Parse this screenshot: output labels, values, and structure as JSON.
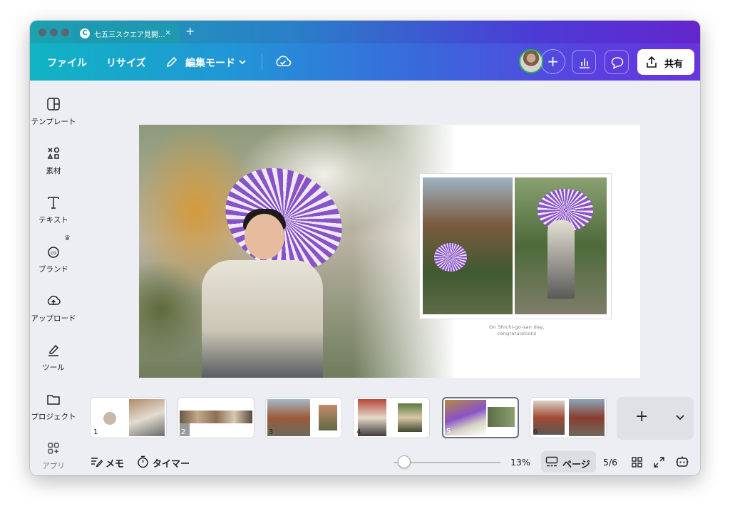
{
  "tab": {
    "title": "七五三スクエア見開...",
    "close": "×",
    "new_tab": "+"
  },
  "toolbar": {
    "file": "ファイル",
    "resize": "リサイズ",
    "edit_mode": "編集モード",
    "add": "+",
    "share": "共有"
  },
  "sidebar": {
    "items": [
      {
        "label": "テンプレート",
        "icon": "template-icon"
      },
      {
        "label": "素材",
        "icon": "elements-icon"
      },
      {
        "label": "テキスト",
        "icon": "text-icon"
      },
      {
        "label": "ブランド",
        "icon": "brand-icon"
      },
      {
        "label": "アップロード",
        "icon": "upload-icon"
      },
      {
        "label": "ツール",
        "icon": "draw-icon"
      },
      {
        "label": "プロジェクト",
        "icon": "folder-icon"
      },
      {
        "label": "アプリ",
        "icon": "apps-icon"
      }
    ]
  },
  "canvas": {
    "caption_line1": "On Shichi-go-san day,",
    "caption_line2": "congratulations"
  },
  "pages": {
    "thumbnails": [
      "1",
      "2",
      "3",
      "4",
      "5",
      "6"
    ],
    "selected": "5",
    "add": "+",
    "more": "⌄"
  },
  "footer": {
    "notes": "メモ",
    "timer": "タイマー",
    "zoom": "13%",
    "zoom_level": 0.13,
    "pages_label": "ページ",
    "page_count": "5/6"
  },
  "colors": {
    "brand_gradient_start": "#10b4c3",
    "brand_gradient_end": "#6834dc",
    "panel_bg": "#eceef3"
  }
}
